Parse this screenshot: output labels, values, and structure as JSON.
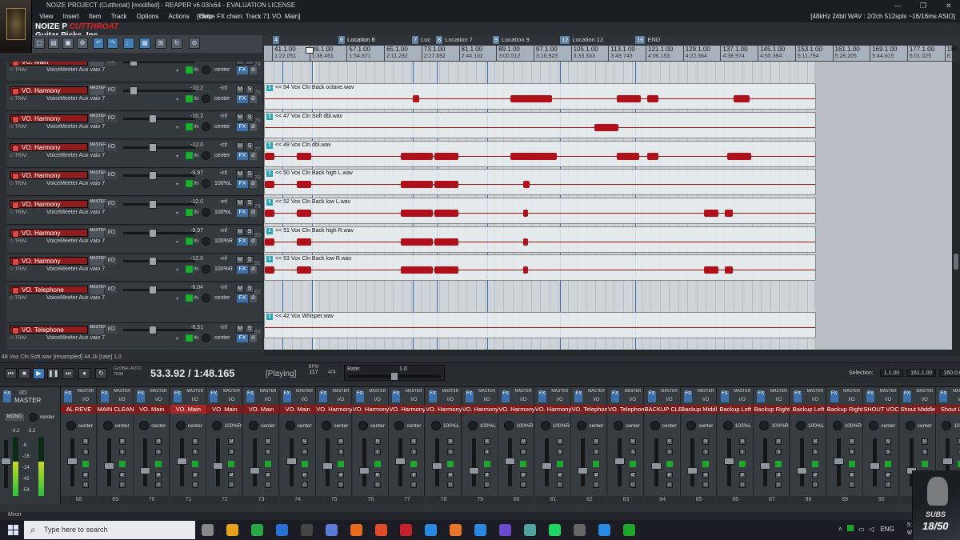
{
  "window": {
    "title": "NOIZE PROJECT (Cutthroat) [modified] - REAPER v6.03/x64 - EVALUATION LICENSE",
    "minimize": "—",
    "maximize": "❐",
    "close": "✕"
  },
  "menu": {
    "items": [
      "View",
      "Insert",
      "Item",
      "Track",
      "Options",
      "Actions",
      "Help"
    ],
    "fx_chain": "[Close FX chain: Track 71 VO. Main]",
    "format": "[48kHz 24bit WAV : 2/2ch 512spls ~16/16ms ASIO]"
  },
  "branding": {
    "project_prefix": "NOIZE P",
    "overlay_text": "CUTTHROAT",
    "label": "Guitar Picks, Inc."
  },
  "toolbar_icons": [
    "new-icon",
    "open-icon",
    "save-icon",
    "settings-icon",
    "undo-icon",
    "redo-icon",
    "metronome-icon",
    "grid-icon",
    "snap-icon",
    "ripple-icon",
    "lock-icon"
  ],
  "markers": [
    {
      "num": "4",
      "label": ""
    },
    {
      "num": "5",
      "label": "Location 5"
    },
    {
      "num": "6",
      "label": "Location 6"
    },
    {
      "num": "7",
      "label": "Loc"
    },
    {
      "num": "8",
      "label": "Location 7"
    },
    {
      "num": "9",
      "label": "Location 9"
    },
    {
      "num": "12",
      "label": "Location 12"
    },
    {
      "num": "16",
      "label": "END"
    }
  ],
  "ruler": [
    {
      "bar": "41.1.00",
      "time": "1:22.051"
    },
    {
      "bar": "49.1.00",
      "time": "1:38.461"
    },
    {
      "bar": "57.1.00",
      "time": "1:54.871"
    },
    {
      "bar": "65.1.00",
      "time": "2:11.282"
    },
    {
      "bar": "73.1.00",
      "time": "2:27.692"
    },
    {
      "bar": "81.1.00",
      "time": "2:44.102"
    },
    {
      "bar": "89.1.00",
      "time": "3:00.512"
    },
    {
      "bar": "97.1.00",
      "time": "3:16.923"
    },
    {
      "bar": "105.1.00",
      "time": "3:33.333"
    },
    {
      "bar": "113.1.00",
      "time": "3:49.743"
    },
    {
      "bar": "121.1.00",
      "time": "4:06.153"
    },
    {
      "bar": "129.1.00",
      "time": "4:22.564"
    },
    {
      "bar": "137.1.00",
      "time": "4:38.974"
    },
    {
      "bar": "145.1.00",
      "time": "4:55.384"
    },
    {
      "bar": "153.1.00",
      "time": "5:11.794"
    },
    {
      "bar": "161.1.00",
      "time": "5:28.205"
    },
    {
      "bar": "169.1.00",
      "time": "5:44.615"
    },
    {
      "bar": "177.1.00",
      "time": "6:01.025"
    },
    {
      "bar": "185.1.00",
      "time": "6:17.435"
    }
  ],
  "tracks": [
    {
      "num": "74",
      "name": "VO. Main",
      "vol": "-0.25",
      "pan": "center",
      "input": "VoiceMeeter Aux vaio 7"
    },
    {
      "num": "75",
      "name": "VO. Harmony",
      "vol": "-10.2",
      "pan": "center",
      "input": "VoiceMeeter Aux vaio 7"
    },
    {
      "num": "76",
      "name": "VO. Harmony",
      "vol": "-10.2",
      "pan": "center",
      "input": "VoiceMeeter Aux vaio 7"
    },
    {
      "num": "77",
      "name": "VO. Harmony",
      "vol": "-12.0",
      "pan": "center",
      "input": "VoiceMeeter Aux vaio 7"
    },
    {
      "num": "78",
      "name": "VO. Harmony",
      "vol": "-9.97",
      "pan": "100%L",
      "input": "VoiceMeeter Aux vaio 7"
    },
    {
      "num": "79",
      "name": "VO. Harmony",
      "vol": "-12.0",
      "pan": "100%L",
      "input": "VoiceMeeter Aux vaio 7"
    },
    {
      "num": "80",
      "name": "VO. Harmony",
      "vol": "-9.97",
      "pan": "100%R",
      "input": "VoiceMeeter Aux vaio 7"
    },
    {
      "num": "81",
      "name": "VO. Harmony",
      "vol": "-12.0",
      "pan": "100%R",
      "input": "VoiceMeeter Aux vaio 7"
    },
    {
      "num": "82",
      "name": "VO. Telephone",
      "vol": "-6.04",
      "pan": "center",
      "input": "VoiceMeeter Aux vaio 7"
    },
    {
      "num": "83",
      "name": "VO. Telephone",
      "vol": "-6.51",
      "pan": "center",
      "input": "VoiceMeeter Aux vaio 7"
    }
  ],
  "track_labels": {
    "master_send": "MASTER",
    "io": "I/O",
    "trim": "TRIM",
    "in": "IN",
    "vol_inf": "-inf",
    "mute": "M",
    "solo": "S",
    "fx": "FX",
    "dropdown": "▾"
  },
  "items": [
    "<< 54 Vox Cln Back octave.wav",
    "<< 47 Vox Cln Soft dbl.wav",
    "<< 49 Vox Cln dbl.wav",
    "<< 50 Vox Cln Back high L.wav",
    "<< 52 Vox Cln Back low L.wav",
    "<< 51 Vox Cln Back high R.wav",
    "<< 53 Vox Cln Back low R.wav",
    "<< 42 Vox Whisper.wav"
  ],
  "item_badge": "1",
  "status_line": "48 Vox Cln Soft.wav [resampled] 44.1k [rate] 1.0",
  "transport": {
    "position": "53.3.92 / 1:48.165",
    "state": "[Playing]",
    "bpm_label": "BPM",
    "bpm": "117",
    "time_sig": "4/4",
    "rate_label": "Rate:",
    "rate": "1.0",
    "global_auto": "GLOBAL AUTO",
    "trim_read": "TRIM",
    "selection_label": "Selection:",
    "sel_start": "1.1.00",
    "sel_end": "161.1.00",
    "sel_len": "160.0.00"
  },
  "mixer": {
    "master_label": "MASTER",
    "mono": "MONO",
    "master_pan": "center",
    "meter_l": "-3.2",
    "meter_r": "-3.2",
    "db_marks": [
      "-6",
      "-18",
      "-24",
      "-42",
      "-54"
    ],
    "strips": [
      {
        "name": "AL REVE",
        "pan": "center",
        "num": "68"
      },
      {
        "name": "MAIN CLEAN",
        "pan": "center",
        "num": "69"
      },
      {
        "name": "VO. Main",
        "pan": "center",
        "num": "70"
      },
      {
        "name": "VO. Main",
        "pan": "center",
        "num": "71"
      },
      {
        "name": "VO. Main",
        "pan": "100%R",
        "num": "72"
      },
      {
        "name": "VO. Main",
        "pan": "center",
        "num": "73"
      },
      {
        "name": "VO. Main",
        "pan": "center",
        "num": "74"
      },
      {
        "name": "VO. Harmony",
        "pan": "center",
        "num": "75"
      },
      {
        "name": "VO. Harmony",
        "pan": "center",
        "num": "76"
      },
      {
        "name": "VO. Harmony",
        "pan": "center",
        "num": "77"
      },
      {
        "name": "VO. Harmony",
        "pan": "100%L",
        "num": "78"
      },
      {
        "name": "VO. Harmony",
        "pan": "100%L",
        "num": "79"
      },
      {
        "name": "VO. Harmony",
        "pan": "100%R",
        "num": "80"
      },
      {
        "name": "VO. Harmony",
        "pan": "100%R",
        "num": "81"
      },
      {
        "name": "VO. Telephon",
        "pan": "center",
        "num": "82"
      },
      {
        "name": "VO. Telephon",
        "pan": "center",
        "num": "83"
      },
      {
        "name": "BACKUP CLE",
        "pan": "center",
        "num": "84"
      },
      {
        "name": "Backup Middl",
        "pan": "center",
        "num": "85"
      },
      {
        "name": "Backup Left",
        "pan": "100%L",
        "num": "86"
      },
      {
        "name": "Backup Right",
        "pan": "100%R",
        "num": "87"
      },
      {
        "name": "Backup Left",
        "pan": "100%L",
        "num": "88"
      },
      {
        "name": "Backup Right",
        "pan": "100%R",
        "num": "89"
      },
      {
        "name": "SHOUT VOCA",
        "pan": "center",
        "num": "90"
      },
      {
        "name": "Shout Middle",
        "pan": "center",
        "num": "91"
      },
      {
        "name": "Shout Left",
        "pan": "100%L",
        "num": "92"
      }
    ],
    "dock_label": "Mixer"
  },
  "taskbar": {
    "search_placeholder": "Type here to search",
    "tray_lang": "ENG",
    "clock_time": "5:44",
    "clock_date": "9/17/..."
  },
  "watermark": {
    "tag": "SUBS",
    "count": "18/50"
  },
  "colors": {
    "track_red": "#8f1c1c",
    "wave_red": "#b0101a",
    "marker_line": "#3a6fb5",
    "fx_blue": "#3d6fa8",
    "arm_green": "#1ea52c"
  }
}
